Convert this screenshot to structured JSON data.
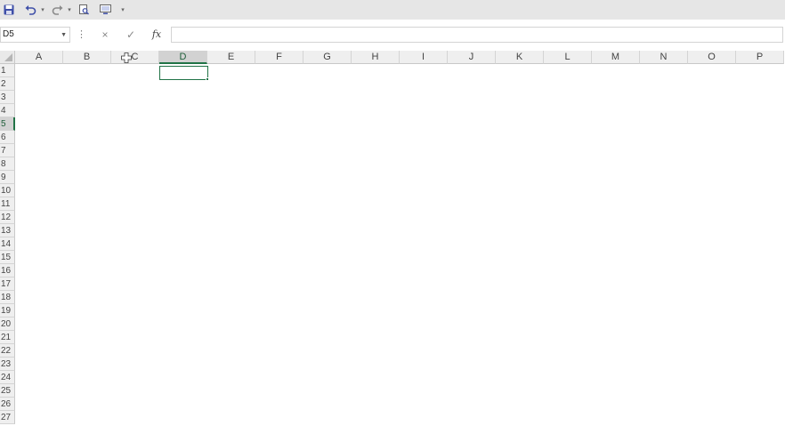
{
  "quick_access": {
    "save": "save-icon",
    "undo": "undo-icon",
    "redo": "redo-icon",
    "print_preview": "print-preview-icon",
    "screen": "screen-icon",
    "customize": "▾"
  },
  "formula_bar": {
    "name_box": "D5",
    "cancel": "×",
    "enter": "✓",
    "fx": "fx",
    "formula": ""
  },
  "sheet": {
    "columns": [
      "A",
      "B",
      "C",
      "D",
      "E",
      "F",
      "G",
      "H",
      "I",
      "J",
      "K",
      "L",
      "M",
      "N",
      "O",
      "P"
    ],
    "rows": [
      "1",
      "2",
      "3",
      "4",
      "5",
      "6",
      "7",
      "8",
      "9",
      "10",
      "11",
      "12",
      "13",
      "14",
      "15",
      "16",
      "17",
      "18",
      "19",
      "20",
      "21",
      "22",
      "23",
      "24",
      "25",
      "26",
      "27"
    ],
    "selected_column": "D",
    "selected_row": "5",
    "accent_color": "#217346"
  }
}
